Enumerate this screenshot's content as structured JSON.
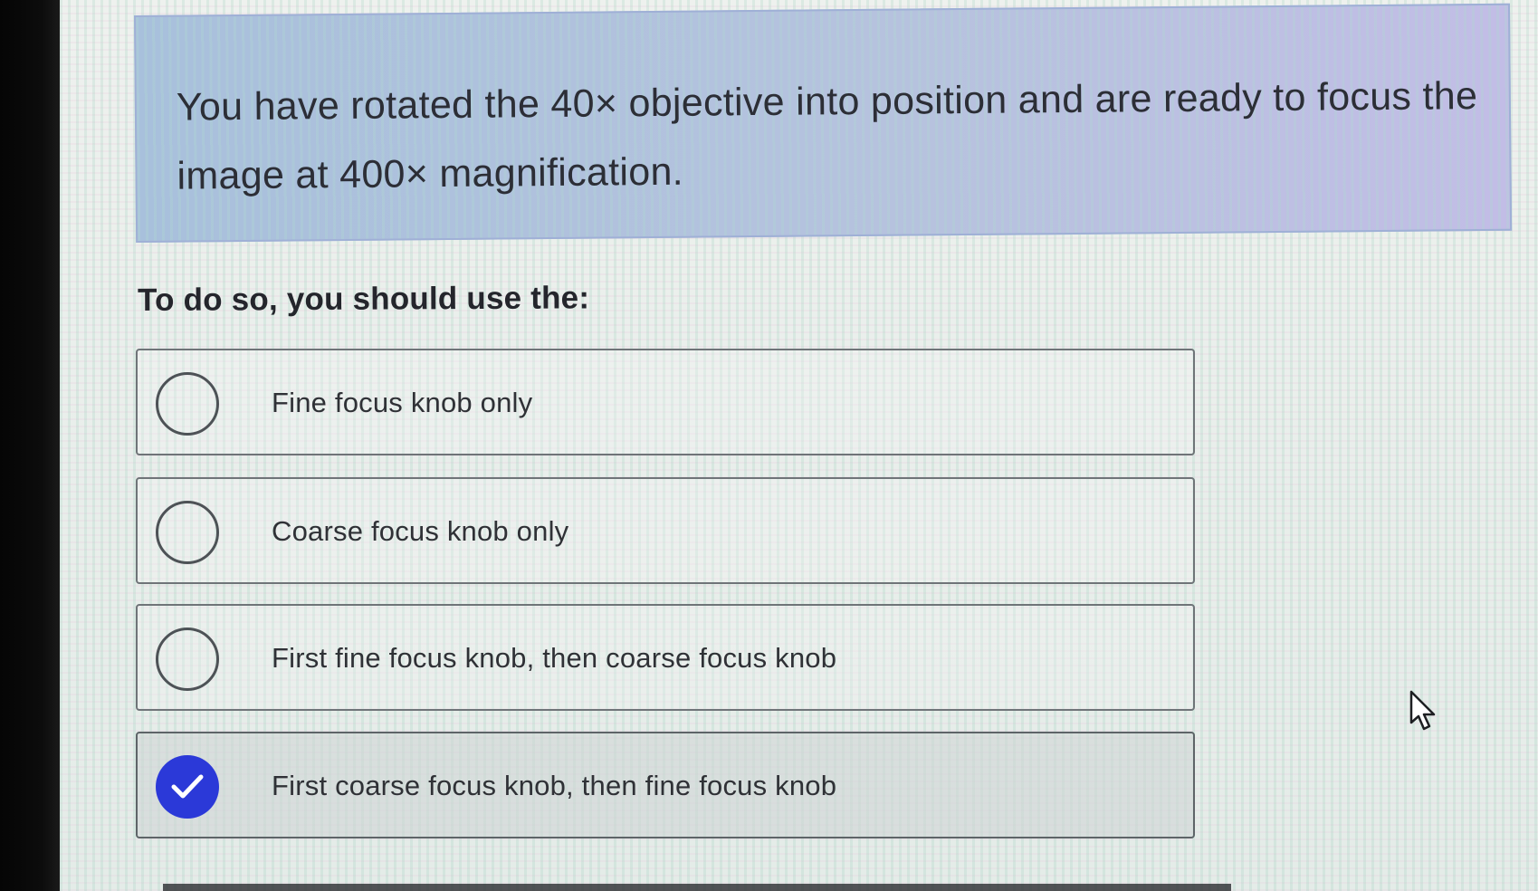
{
  "question": {
    "text": "You have rotated the 40× objective into position and are ready to focus the image at 400× magnification."
  },
  "instruction": "To do so, you should use the:",
  "options": [
    {
      "label": "Fine focus knob only",
      "selected": false
    },
    {
      "label": "Coarse focus knob only",
      "selected": false
    },
    {
      "label": "First fine focus knob, then coarse focus knob",
      "selected": false
    },
    {
      "label": "First coarse focus knob, then fine focus knob",
      "selected": true
    }
  ],
  "colors": {
    "question_background": "#b6c2de",
    "selected_radio": "#2b39d8",
    "option_border": "#6f7478"
  },
  "icons": {
    "checkmark": "checkmark-icon",
    "cursor": "mouse-pointer-icon"
  }
}
